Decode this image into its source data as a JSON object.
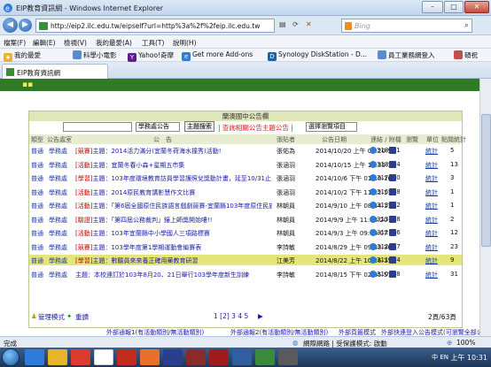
{
  "window": {
    "title": "EIP教育資訊網 - Windows Internet Explorer",
    "buttons": [
      "–",
      "□",
      "✕"
    ]
  },
  "address": {
    "url": "http://eip2.ilc.edu.tw/eipself?url=http%3a%2f%2feip.ilc.edu.tw",
    "search_placeholder": "Bing"
  },
  "menu": [
    "檔案(F)",
    "編輯(E)",
    "檢視(V)",
    "我的最愛(A)",
    "工具(T)",
    "說明(H)"
  ],
  "favorites": {
    "label": "我的最愛",
    "items": [
      "科學小電影",
      "Yahoo!奇摩",
      "Get more Add-ons",
      "Synology DiskStation - D...",
      "員工業務網登入",
      "碩祝"
    ]
  },
  "tab": {
    "label": "EIP教育資訊網"
  },
  "page": {
    "panel_title": "蘭澳國中公告欄",
    "search": {
      "input_value": "",
      "select_value": "學務處公告",
      "button": "主題搜索",
      "link": "| 查詢相關公告主題公告 |",
      "sort_select": "選擇瀏覽項目"
    },
    "columns": [
      "類型",
      "公告處室",
      "公　告",
      "張貼者",
      "公告日期",
      "連結 / 附檔",
      "瀏覽",
      "單位",
      "點閱統計"
    ],
    "rows": [
      {
        "type": "普通",
        "office": "學務處",
        "tag": "[競賽]",
        "subject": "主題：2014活力滿分(宜蘭冬荷海水撞秀)活動!",
        "poster": "張佑為",
        "date": "2014/10/20 上午 09:20:58",
        "hits": "318861",
        "stat": "統計",
        "count": "5"
      },
      {
        "type": "普通",
        "office": "學務處",
        "tag": "[活動]",
        "subject": "主題：宜蘭冬春小森+星期五市集",
        "poster": "張涵羽",
        "date": "2014/10/15 上午 10:35:33",
        "hits": "318354",
        "stat": "統計",
        "count": "13"
      },
      {
        "type": "普通",
        "office": "學務處",
        "tag": "[學習]",
        "subject": "主題：103年度環境教育訪員學習護照兌獎動計畫，延至10/31止，請新學及家長踴躍參加！",
        "poster": "張涵羽",
        "date": "2014/10/6 下午 01:10:16",
        "hits": "317280",
        "stat": "統計",
        "count": "3"
      },
      {
        "type": "普通",
        "office": "學務處",
        "tag": "[活動]",
        "subject": "主題：2014原民教育講影慧作文比賽",
        "poster": "張涵羽",
        "date": "2014/10/2 下午 11:22:11",
        "hits": "316848",
        "stat": "統計",
        "count": "1"
      },
      {
        "type": "普通",
        "office": "學務處",
        "tag": "[活動]",
        "subject": "主題：「第6屆全國原住民族語言戲劇競賽-宜蘭縣103年度原住民族語戲劇競賽初賽」活動",
        "poster": "林朝員",
        "date": "2014/9/10 上午 08:44:11",
        "hits": "313622",
        "stat": "統計",
        "count": "1"
      },
      {
        "type": "普通",
        "office": "學務處",
        "tag": "[驗證]",
        "subject": "主題：「第四屆公務裁判」鐘上師獎開始嘍!!",
        "poster": "林朝員",
        "date": "2014/9/9 上午 11:38:20",
        "hits": "313488",
        "stat": "統計",
        "count": "2"
      },
      {
        "type": "普通",
        "office": "學務處",
        "tag": "[活動]",
        "subject": "主題：103年宜蘭縣中小學國人三項路標賽",
        "poster": "林朝員",
        "date": "2014/9/3 上午 09:00:07",
        "hits": "312756",
        "stat": "統計",
        "count": "12"
      },
      {
        "type": "普通",
        "office": "學務處",
        "tag": "[競賽]",
        "subject": "主題：103學年度第1學期運動會編賽表",
        "poster": "李詩敏",
        "date": "2014/8/29 上午 09:33:36",
        "hits": "312087",
        "stat": "統計",
        "count": "23"
      },
      {
        "type": "普通",
        "office": "學務處",
        "tag": "[學習]",
        "subject": "主題：數聽員來來養正確用藥教育研習",
        "poster": "江美芳",
        "date": "2014/8/22 上午 10:26:15",
        "hits": "311404",
        "stat": "統計",
        "count": "9"
      },
      {
        "type": "普通",
        "office": "學務處",
        "tag": "",
        "subject": "主題：本校連訂於103年8月20、21日舉行103學年度新生訓練",
        "poster": "李詩敏",
        "date": "2014/8/15 下午 02:05:57",
        "hits": "310808",
        "stat": "統計",
        "count": "31"
      }
    ],
    "pager": {
      "manage": "管理模式",
      "refresh": "重讀",
      "pages": "1 [2] 3 4 5",
      "summary": "2頁/63頁"
    },
    "bottom_links": [
      "外部通報1(有活動類別/無活動類別)",
      "外部通報2(有活動類別/無活動類別)",
      "外部頁籤模式",
      "外部快連登入公告模式(可瀏覽全部公告)"
    ]
  },
  "status": {
    "left": "完成",
    "zone": "網際網路 | 受保護模式: 啟動",
    "zoom": "100%"
  },
  "taskbar": {
    "lang": "中 EN",
    "clock": "上午 10:31"
  },
  "colors": {
    "accent_green": "#2f7b25",
    "highlight_row": "#e5e67a",
    "tag_red": "#b00000",
    "link_blue": "#1a1aa8"
  }
}
